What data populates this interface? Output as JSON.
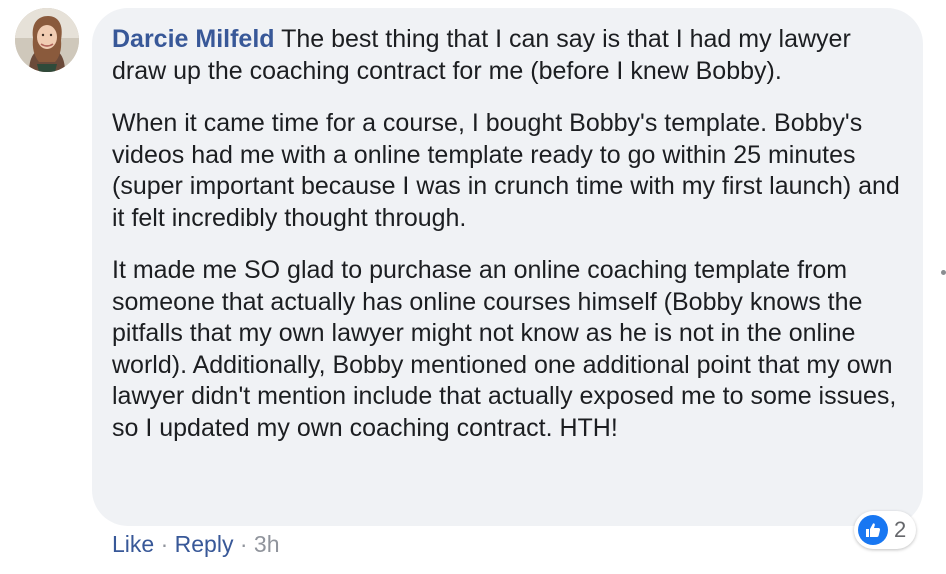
{
  "comment": {
    "author": "Darcie Milfeld",
    "paragraphs": [
      "The best thing that I can say is that I had my lawyer draw up the coaching contract for me (before I knew Bobby).",
      "When it came time for a course, I bought Bobby's template. Bobby's videos had me with a online template ready to go within 25 minutes (super important because I was in crunch time with my first launch) and it felt incredibly thought through.",
      "It made me SO glad to purchase an online coaching template from someone that actually has online courses himself (Bobby knows the pitfalls that my own lawyer might not know as he is not in the online world). Additionally, Bobby mentioned one additional point that my own lawyer didn't mention include that actually exposed me to some issues, so I updated my own coaching contract. HTH!"
    ],
    "reaction_count": "2",
    "reaction_icon": "thumbs-up-icon"
  },
  "actions": {
    "like_label": "Like",
    "separator": "·",
    "reply_label": "Reply",
    "timestamp": "3h"
  },
  "colors": {
    "author": "#385898",
    "bubble_bg": "#f0f2f5",
    "text": "#1c1e21",
    "like_blue": "#1877f2",
    "meta_gray": "#90949c"
  }
}
